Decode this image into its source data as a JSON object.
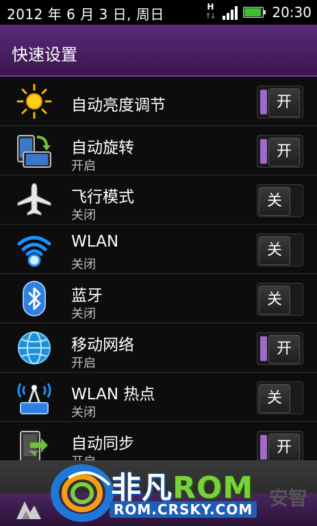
{
  "status_bar": {
    "date": "2012 年 6 月 3 日, 周日",
    "network_letter": "H",
    "time": "20:30"
  },
  "header": {
    "title": "快速设置"
  },
  "settings": [
    {
      "title": "自动亮度调节",
      "subtitle": "",
      "toggle": "开",
      "state": "on",
      "icon": "sun-icon"
    },
    {
      "title": "自动旋转",
      "subtitle": "开启",
      "toggle": "开",
      "state": "on",
      "icon": "rotate-icon"
    },
    {
      "title": "飞行模式",
      "subtitle": "关闭",
      "toggle": "关",
      "state": "off",
      "icon": "airplane-icon"
    },
    {
      "title": "WLAN",
      "subtitle": "关闭",
      "toggle": "关",
      "state": "off",
      "icon": "wifi-icon"
    },
    {
      "title": "蓝牙",
      "subtitle": "关闭",
      "toggle": "关",
      "state": "off",
      "icon": "bluetooth-icon"
    },
    {
      "title": "移动网络",
      "subtitle": "开启",
      "toggle": "开",
      "state": "on",
      "icon": "globe-icon"
    },
    {
      "title": "WLAN 热点",
      "subtitle": "关闭",
      "toggle": "关",
      "state": "off",
      "icon": "hotspot-icon"
    },
    {
      "title": "自动同步",
      "subtitle": "开启",
      "toggle": "开",
      "state": "on",
      "icon": "sync-icon"
    }
  ],
  "watermark": {
    "brand_part1": "非凡",
    "brand_part2": "ROM",
    "url": "ROM.CRSKY.COM",
    "side_text": "安智"
  },
  "colors": {
    "header": "#5a2a7a",
    "toggle_on": "#a06bc8",
    "battery": "#3fbf2f"
  }
}
